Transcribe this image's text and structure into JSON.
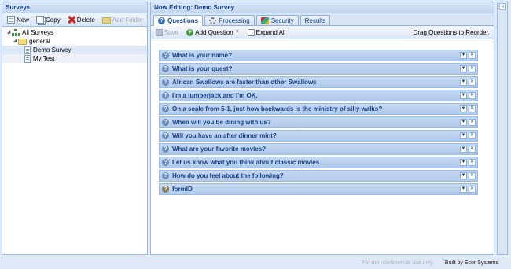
{
  "left_panel": {
    "title": "Surveys",
    "toolbar": {
      "new_label": "New",
      "copy_label": "Copy",
      "delete_label": "Delete",
      "add_folder_label": "Add Folder"
    },
    "tree": [
      {
        "label": "All Surveys",
        "icon": "tree-icon",
        "level": 0,
        "state": "normal"
      },
      {
        "label": "general",
        "icon": "folder-icon",
        "level": 1,
        "state": "normal"
      },
      {
        "label": "Demo Survey",
        "icon": "document-icon",
        "level": 2,
        "state": "selected"
      },
      {
        "label": "My Test",
        "icon": "document-icon",
        "level": 2,
        "state": "hover"
      }
    ]
  },
  "main_panel": {
    "title": "Now Editing: Demo Survey",
    "tabs": [
      {
        "label": "Questions",
        "icon": "question-icon",
        "active": true
      },
      {
        "label": "Processing",
        "icon": "gear-icon",
        "active": false
      },
      {
        "label": "Security",
        "icon": "security-icon",
        "active": false
      },
      {
        "label": "Results",
        "icon": "",
        "active": false
      }
    ],
    "toolbar": {
      "save_label": "Save",
      "add_question_label": "Add Question",
      "expand_all_label": "Expand All",
      "hint": "Drag Questions to Reorder."
    },
    "questions": [
      "What is your name?",
      "What is your quest?",
      "African Swallows are faster than other Swallows",
      "I'm a lumberjack and I'm OK.",
      "On a scale from 5-1, just how backwards is the ministry of silly walks?",
      "When will you be dining with us?",
      "Will you have an after dinner mint?",
      "What are your favorite movies?",
      "Let us know what you think about classic movies.",
      "How do you feel about the following?",
      "formID"
    ]
  },
  "footer": {
    "notice": "For non-commercial use only.",
    "credit": "Built by Ecor Systems"
  },
  "colors": {
    "header_text": "#15428b",
    "border": "#99bbe8",
    "background": "#dfe8f6"
  }
}
